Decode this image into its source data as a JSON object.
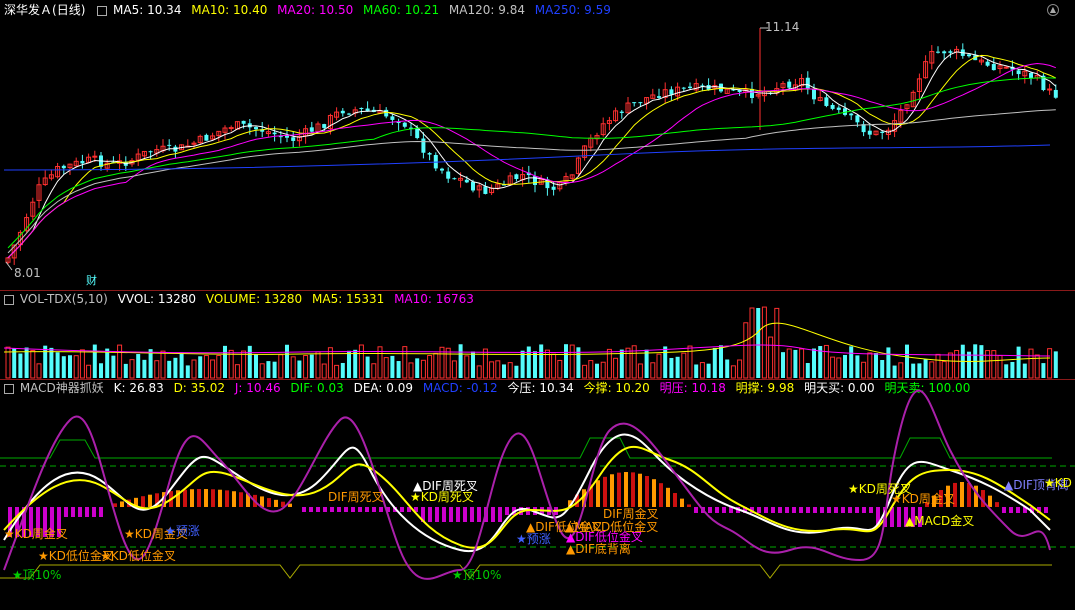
{
  "main_header": {
    "stock_name": "深华发Ａ",
    "period": "(日线)",
    "ma5": "MA5: 10.34",
    "ma10": "MA10: 10.40",
    "ma20": "MA20: 10.50",
    "ma60": "MA60: 10.21",
    "ma120": "MA120: 9.84",
    "ma250": "MA250: 9.59"
  },
  "main_chart": {
    "high_marker": "11.14",
    "low_marker": "8.01",
    "cai_label": "财"
  },
  "vol_header": {
    "name": "VOL-TDX(5,10)",
    "vvol": "VVOL: 13280",
    "volume": "VOLUME: 13280",
    "ma5": "MA5: 15331",
    "ma10": "MA10: 16763"
  },
  "macd_header": {
    "name": "MACD神器抓妖",
    "k": "K: 26.83",
    "d": "D: 35.02",
    "j": "J: 10.46",
    "dif": "DIF: 0.03",
    "dea": "DEA: 0.09",
    "macd": "MACD: -0.12",
    "jinya": "今压: 10.34",
    "jincheng": "今撑: 10.20",
    "mingya": "明压: 10.18",
    "mingcheng": "明撑: 9.98",
    "mingtian_mai": "明天买: 0.00",
    "mingtian_mai2": "明天卖: 100.00"
  },
  "signals": [
    {
      "text": "★KD周金叉",
      "color": "#ff9900"
    },
    {
      "text": "★KD低位金叉",
      "color": "#ff9900"
    },
    {
      "text": "★KD低位金叉",
      "color": "#ff9900"
    },
    {
      "text": "★顶10%",
      "color": "#00cc00"
    },
    {
      "text": "★KD周金叉",
      "color": "#ff9900"
    },
    {
      "text": "★预涨",
      "color": "#4060ff"
    },
    {
      "text": "DIF周死叉",
      "color": "#ff9900"
    },
    {
      "text": "▲DIF周死叉",
      "color": "#ffffff"
    },
    {
      "text": "★KD周死叉",
      "color": "#ffff00"
    },
    {
      "text": "★顶10%",
      "color": "#00cc00"
    },
    {
      "text": "▲DIF低位金叉",
      "color": "#ff9900"
    },
    {
      "text": "★预涨",
      "color": "#4060ff"
    },
    {
      "text": "▲MACD低位金叉",
      "color": "#ff9900"
    },
    {
      "text": "▲DIF低位金叉",
      "color": "#ff00ff"
    },
    {
      "text": "▲DIF底背离",
      "color": "#ff9900"
    },
    {
      "text": "DIF周金叉",
      "color": "#ff9900"
    },
    {
      "text": "★KD周死叉",
      "color": "#ffff00"
    },
    {
      "text": "★KD周金叉",
      "color": "#ff9900"
    },
    {
      "text": "▲MACD金叉",
      "color": "#ffff00"
    },
    {
      "text": "▲DIF顶背离",
      "color": "#8080ff"
    },
    {
      "text": "★KD",
      "color": "#ffff00"
    }
  ],
  "colors": {
    "up": "#ff3030",
    "down": "#54fcfc",
    "ma5": "#ffffff",
    "ma10": "#ffff00",
    "ma20": "#ff00ff",
    "ma60": "#00ff00",
    "ma120": "#c0c0c0",
    "ma250": "#2040ff"
  }
}
